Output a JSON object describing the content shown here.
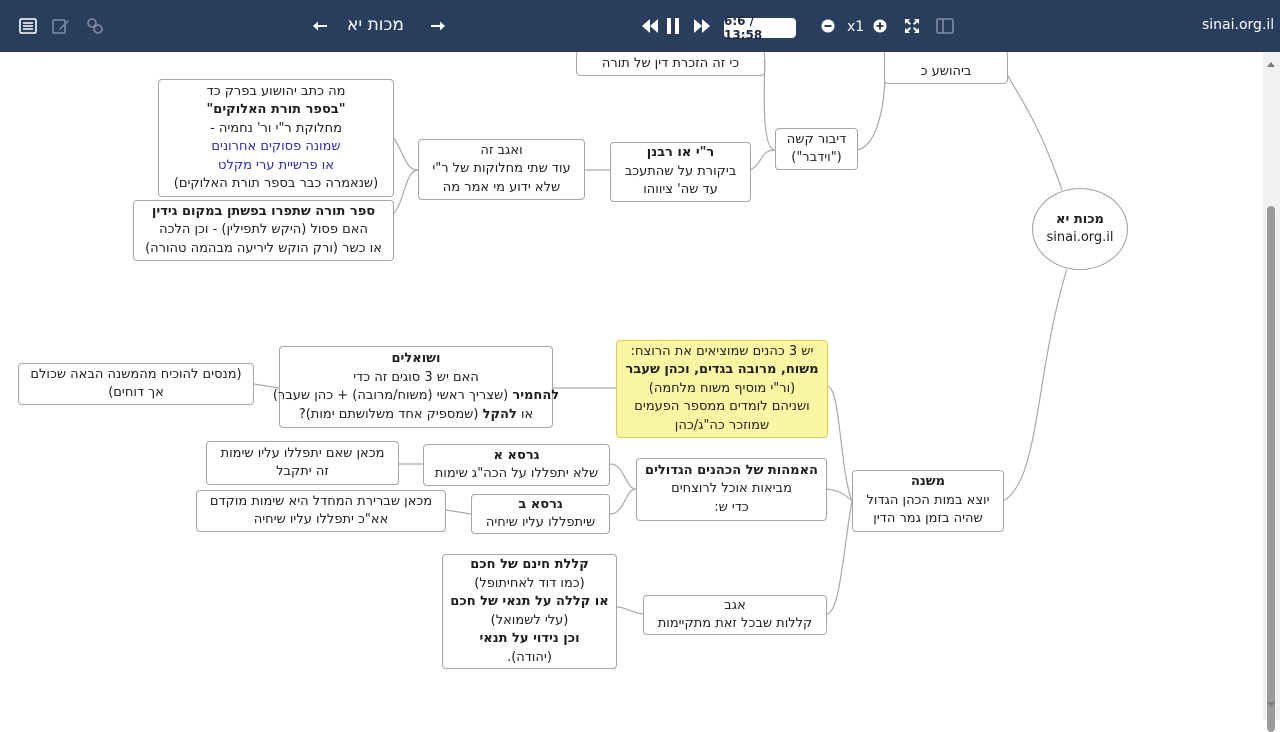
{
  "toolbar": {
    "title": "מכות יא",
    "time": "6:6 / 13:58",
    "speed": "x1",
    "site": "sinai.org.il",
    "icons": [
      "list-icon",
      "edit-icon",
      "link-icon",
      "arrow-left-icon",
      "arrow-right-icon",
      "rewind-icon",
      "pause-icon",
      "fast-forward-icon",
      "zoom-out-icon",
      "zoom-in-icon",
      "fullscreen-icon",
      "split-view-icon"
    ],
    "colors": {
      "bar": "#293e5d",
      "highlight": "#fbf6a3"
    }
  },
  "map": {
    "root": {
      "line1": "מכות יא",
      "line2": "sinai.org.il"
    },
    "top_clip_a": "כי זה הזכרת דין של תורה",
    "top_clip_b": "ביהושע כ",
    "dibur": {
      "line1": "דיבור קשה",
      "line2": "(\"וידבר\")"
    },
    "rav": {
      "line1": "ר\"י או רבנן",
      "line2": "ביקורת על שהתעכב",
      "line3": "עד שה' ציווהו"
    },
    "agav1": {
      "line1": "ואגב זה",
      "line2": "עוד שתי מחלוקות של ר\"י",
      "line3": "שלא ידוע מי אמר מה"
    },
    "yehoshua": {
      "line1": "מה כתב יהושוע בפרק כד",
      "line2": "\"בספר תורת האלוקים\"",
      "line3": "מחלוקת ר\"י ור' נחמיה -",
      "line4": "שמונה פסוקים אחרונים",
      "line5": "או פרשיית ערי מקלט",
      "line6": "(שנאמרה כבר בספר תורת האלוקים)"
    },
    "sefer": {
      "line1": "ספר תורה שתפרו בפשתן במקום גידין",
      "line2": "האם פסול (היקש לתפילין) - וכן הלכה",
      "line3": "או כשר (ורק הוקש ליריעה מבהמה טהורה)"
    },
    "mishna": {
      "line1": "משנה",
      "line2": "יוצא במות הכהן הגדול",
      "line3": "שהיה בזמן גמר הדין"
    },
    "kohanim": {
      "line1": "יש 3 כהנים שמוציאים את הרוצח:",
      "line2": "משוח, מרובה בגדים, וכהן שעבר",
      "line3": "(ור\"י מוסיף משוח מלחמה)",
      "line4": "ושניהם לומדים ממספר הפעמים",
      "line5": "שמוזכר כה\"ג/כהן"
    },
    "shoalim": {
      "line1": "ושואלים",
      "line2": "האם יש 3 סוגים זה כדי",
      "line3a": "להחמיר",
      "line3b": "(שצריך ראשי (משוח/מרובה) + כהן שעבר)",
      "line4a": "או",
      "line4b": "להקל",
      "line4c": "(שמספיק אחד משלושתם ימות)?"
    },
    "mnasim": {
      "line1": "(מנסים להוכיח מהמשנה הבאה שכולם",
      "line2": "אך דוחים)"
    },
    "imahot": {
      "line1": "האמהות של הכהנים הגדולים",
      "line2": "מביאות אוכל לרוצחים",
      "line3": "כדי ש:"
    },
    "girsa_a": {
      "line1": "גרסא א",
      "line2": "שלא יתפללו על הכה\"ג שימות"
    },
    "girsa_a_note": {
      "line1": "מכאן שאם יתפללו עליו שימות",
      "line2": "זה יתקבל"
    },
    "girsa_b": {
      "line1": "גרסא ב",
      "line2": "שיתפללו עליו שיחיה"
    },
    "girsa_b_note": {
      "line1": "מכאן שברירת המחדל היא שימות מוקדם",
      "line2": "אא\"כ יתפללו עליו שיחיה"
    },
    "agav2": {
      "line1": "אגב",
      "line2": "קללות שבכל זאת מתקיימות"
    },
    "klalot": {
      "line1": "קללת חינם של חכם",
      "line2": "(כמו דוד לאחיתופל)",
      "line3": "או קללה על תנאי של חכם",
      "line4": "(עלי לשמואל)",
      "line5": "וכן נידוי על תנאי",
      "line6": "(יהודה)."
    }
  }
}
